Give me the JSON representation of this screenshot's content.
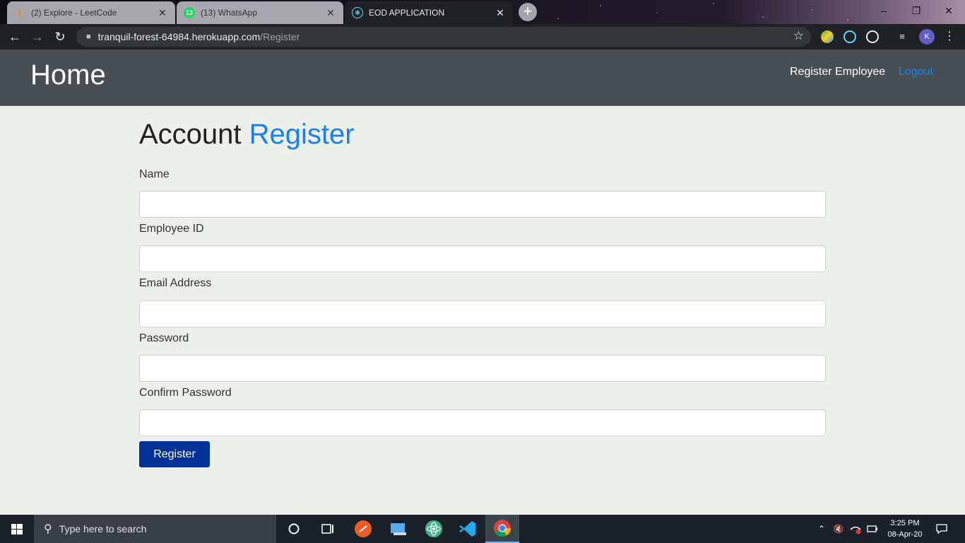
{
  "browser": {
    "tabs": [
      {
        "title": "(2) Explore - LeetCode",
        "icon": "leetcode-icon"
      },
      {
        "title": "(13) WhatsApp",
        "icon": "whatsapp-icon",
        "badge": "13"
      },
      {
        "title": "EOD APPLICATION",
        "icon": "react-icon"
      }
    ],
    "url_host": "tranquil-forest-64984.herokuapp.com",
    "url_path": "/Register",
    "profile_initial": "K"
  },
  "navbar": {
    "brand": "Home",
    "links": {
      "register_employee": "Register Employee",
      "logout": "Logout"
    },
    "link_color": "#1a7ff0"
  },
  "form": {
    "title_prefix": "Account",
    "title_highlight": "Register",
    "fields": [
      {
        "label": "Name",
        "value": ""
      },
      {
        "label": "Employee ID",
        "value": ""
      },
      {
        "label": "Email Address",
        "value": ""
      },
      {
        "label": "Password",
        "value": ""
      },
      {
        "label": "Confirm Password",
        "value": ""
      }
    ],
    "submit_label": "Register",
    "submit_color": "#003297"
  },
  "taskbar": {
    "search_placeholder": "Type here to search",
    "time": "3:25 PM",
    "date": "08-Apr-20"
  }
}
